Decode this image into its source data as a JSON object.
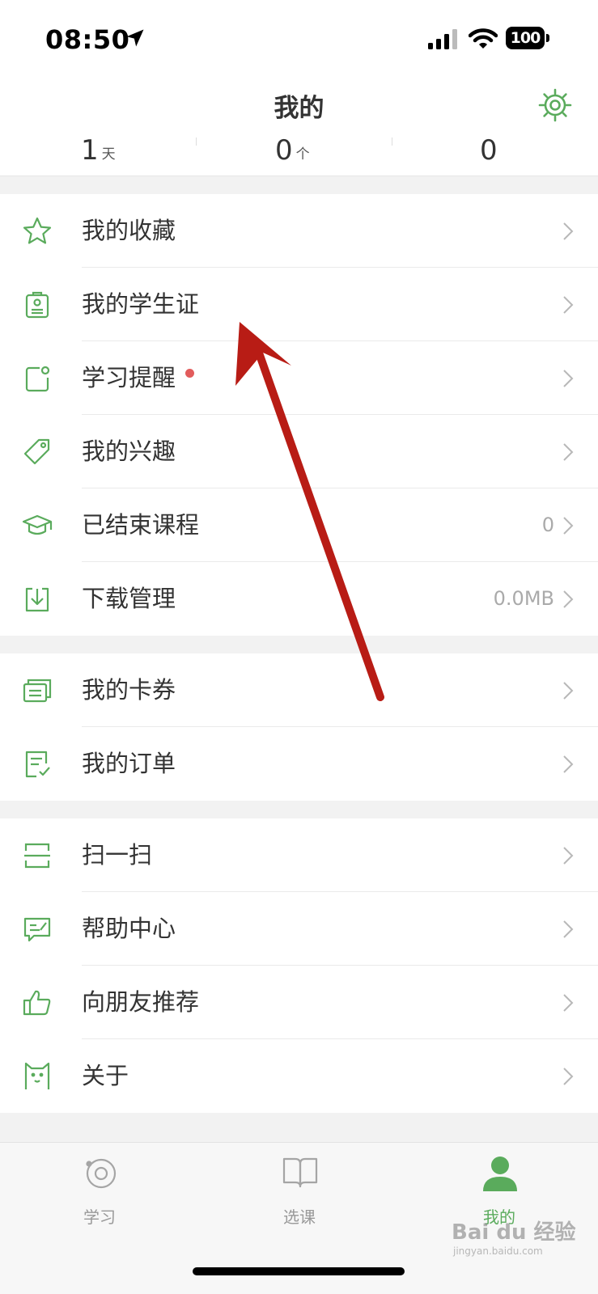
{
  "status_bar": {
    "time": "08:50",
    "battery": "100"
  },
  "header": {
    "title": "我的"
  },
  "stats": [
    {
      "value": "1",
      "unit": "天"
    },
    {
      "value": "0",
      "unit": "个"
    },
    {
      "value": "0",
      "unit": ""
    }
  ],
  "menu": {
    "group1": [
      {
        "label": "我的收藏",
        "icon": "star-icon"
      },
      {
        "label": "我的学生证",
        "icon": "student-card-icon"
      },
      {
        "label": "学习提醒",
        "icon": "reminder-icon",
        "badge_dot": true
      },
      {
        "label": "我的兴趣",
        "icon": "tag-icon"
      },
      {
        "label": "已结束课程",
        "icon": "graduation-cap-icon",
        "value": "0"
      },
      {
        "label": "下载管理",
        "icon": "download-icon",
        "value": "0.0MB"
      }
    ],
    "group2": [
      {
        "label": "我的卡券",
        "icon": "coupon-icon"
      },
      {
        "label": "我的订单",
        "icon": "order-icon"
      }
    ],
    "group3": [
      {
        "label": "扫一扫",
        "icon": "scan-icon"
      },
      {
        "label": "帮助中心",
        "icon": "help-icon"
      },
      {
        "label": "向朋友推荐",
        "icon": "thumbs-up-icon"
      },
      {
        "label": "关于",
        "icon": "about-icon"
      }
    ]
  },
  "tabbar": [
    {
      "label": "学习",
      "icon": "study-icon",
      "active": false
    },
    {
      "label": "选课",
      "icon": "book-icon",
      "active": false
    },
    {
      "label": "我的",
      "icon": "profile-icon",
      "active": true
    }
  ],
  "watermark": {
    "text": "Bai du 经验",
    "sub": "jingyan.baidu.com"
  },
  "colors": {
    "accent": "#5aab5c",
    "badge": "#e25c5c",
    "annotation_arrow": "#b81c15"
  }
}
